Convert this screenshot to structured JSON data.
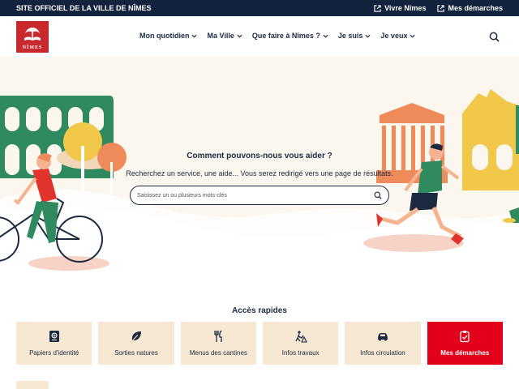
{
  "topbar": {
    "site_label": "SITE OFFICIEL DE LA VILLE DE NÎMES",
    "links": [
      {
        "label": "Vivre Nîmes",
        "icon": "external-link-icon"
      },
      {
        "label": "Mes démarches",
        "icon": "external-link-icon"
      }
    ]
  },
  "header": {
    "logo_text": "NÎMES",
    "nav": [
      {
        "label": "Mon quotidien"
      },
      {
        "label": "Ma Ville"
      },
      {
        "label": "Que faire à Nîmes ?"
      },
      {
        "label": "Je suis"
      },
      {
        "label": "Je veux"
      }
    ]
  },
  "hero": {
    "title": "Comment pouvons-nous vous aider ?",
    "subtitle": "Recherchez un service, une aide... Vous serez redirigé vers une page de résultats.",
    "search_placeholder": "Saisissez un ou plusieurs mots-clés"
  },
  "quick_access": {
    "title": "Accès rapides",
    "items": [
      {
        "label": "Papiers d'identité",
        "icon": "passport-icon"
      },
      {
        "label": "Sorties natures",
        "icon": "leaf-icon"
      },
      {
        "label": "Menus des cantines",
        "icon": "cutlery-icon"
      },
      {
        "label": "Infos travaux",
        "icon": "roadwork-icon"
      },
      {
        "label": "Infos circulation",
        "icon": "car-icon"
      },
      {
        "label": "Mes démarches",
        "icon": "clipboard-check-icon"
      }
    ]
  },
  "colors": {
    "dark_navy": "#13233d",
    "brand_red": "#c9282d",
    "active_red": "#e2001a",
    "card_beige": "#f7e8d3",
    "hero_bg": "#fbf6ee"
  }
}
